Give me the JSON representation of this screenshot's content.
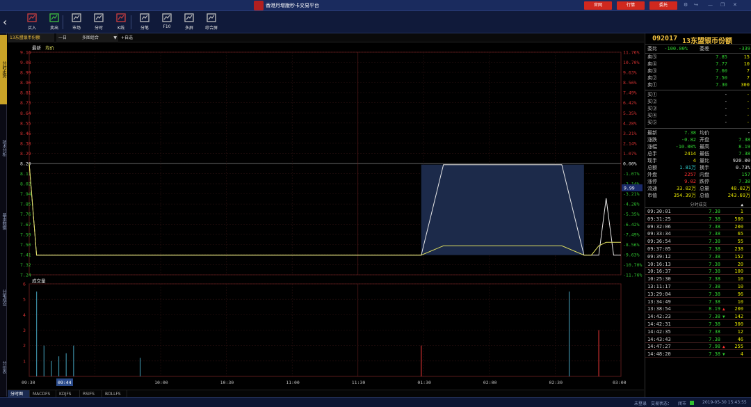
{
  "window": {
    "title": "香港月增版秒卡交易平台",
    "buttons": [
      "官网",
      "行情",
      "委托"
    ],
    "icons": [
      "settings-icon",
      "exit-icon",
      "minimize-icon",
      "restore-icon",
      "close-icon"
    ]
  },
  "toolbar": {
    "items": [
      {
        "label": "买入",
        "icon": "buy-icon",
        "color": "#d04040"
      },
      {
        "label": "卖出",
        "icon": "sell-icon",
        "color": "#40c040"
      },
      {
        "label": "市场",
        "icon": "market-icon",
        "color": "#c0c0c0"
      },
      {
        "label": "分时",
        "icon": "timeshare-icon",
        "color": "#c0c0c0"
      },
      {
        "label": "K线",
        "icon": "candlestick-icon",
        "color": "#d04040"
      },
      {
        "label": "分笔",
        "icon": "ticks-icon",
        "color": "#c0c0c0"
      },
      {
        "label": "F10",
        "icon": "document-icon",
        "color": "#c0c0c0"
      },
      {
        "label": "多屏",
        "icon": "multi-screen-icon",
        "color": "#c0c0c0"
      },
      {
        "label": "综合屏",
        "icon": "grid-screen-icon",
        "color": "#c0c0c0"
      }
    ]
  },
  "left_tabs": [
    "分时走势",
    "技术分析",
    "基本数据",
    "分笔成交",
    "分价表"
  ],
  "chart_bar": {
    "code_name": "13东盟银币份额",
    "period": "一日",
    "mode": "多图组合",
    "add_button": "+自选"
  },
  "bottom_tabs": [
    "分时图",
    "MACDFS",
    "KDJFS",
    "RSIFS",
    "BOLLFS"
  ],
  "status": {
    "login": "未登录",
    "trade_state": "交易状态：",
    "market_state": "闭市",
    "datetime": "2019-05-30 15:43:55"
  },
  "chart_data": {
    "type": "line",
    "legend": [
      "最新",
      "均价"
    ],
    "x_ticks": [
      "09:30",
      "09:44",
      "10:00",
      "10:30",
      "11:00",
      "11:30",
      "01:30",
      "02:00",
      "02:30",
      "03:00"
    ],
    "x_highlight": "09:44",
    "y_left_ticks": [
      "9.16",
      "9.08",
      "8.99",
      "8.90",
      "8.81",
      "8.73",
      "8.64",
      "8.55",
      "8.46",
      "8.38",
      "8.29",
      "8.20",
      "8.11",
      "8.02",
      "7.94",
      "7.85",
      "7.76",
      "7.67",
      "7.59",
      "7.50",
      "7.41",
      "7.32",
      "7.24"
    ],
    "y_right_ticks": [
      "11.76%",
      "10.70%",
      "9.63%",
      "8.56%",
      "7.49%",
      "6.42%",
      "5.35%",
      "4.28%",
      "3.21%",
      "2.14%",
      "1.07%",
      "0.00%",
      "-1.07%",
      "-2.14%",
      "-3.21%",
      "-4.28%",
      "-5.35%",
      "-6.42%",
      "-7.49%",
      "-8.56%",
      "-9.63%",
      "-10.70%",
      "-11.76%"
    ],
    "cursor_label": "9.99",
    "ylim": [
      7.24,
      9.16
    ],
    "prev_close": 8.2,
    "series": [
      {
        "name": "最新",
        "color": "#e8e8e8",
        "x": [
          0,
          1,
          2,
          53,
          56,
          72,
          75,
          76,
          77,
          78,
          79,
          80
        ],
        "y": [
          8.2,
          7.41,
          7.41,
          7.41,
          8.19,
          8.19,
          7.41,
          7.41,
          7.41,
          7.9,
          7.41,
          7.41
        ]
      },
      {
        "name": "均价",
        "color": "#e0e060",
        "x": [
          0,
          1,
          2,
          53,
          56,
          72,
          75,
          76,
          77,
          78,
          79,
          80
        ],
        "y": [
          8.2,
          7.41,
          7.41,
          7.41,
          7.49,
          7.49,
          7.41,
          7.41,
          7.49,
          7.52,
          7.52,
          7.52
        ]
      }
    ],
    "volume": {
      "title": "成交量",
      "y_ticks": [
        "6",
        "5",
        "4",
        "3",
        "2",
        "1"
      ],
      "ylim": [
        0,
        6
      ],
      "bars": [
        {
          "x": 1,
          "v": 5.5,
          "dir": "flat"
        },
        {
          "x": 2,
          "v": 2,
          "dir": "flat"
        },
        {
          "x": 3,
          "v": 1,
          "dir": "flat"
        },
        {
          "x": 4,
          "v": 1.3,
          "dir": "flat"
        },
        {
          "x": 5,
          "v": 1.5,
          "dir": "flat"
        },
        {
          "x": 6,
          "v": 2,
          "dir": "flat"
        },
        {
          "x": 15,
          "v": 1.2,
          "dir": "flat"
        },
        {
          "x": 53,
          "v": 2,
          "dir": "up"
        },
        {
          "x": 73,
          "v": 5.5,
          "dir": "flat"
        },
        {
          "x": 77,
          "v": 3,
          "dir": "up"
        }
      ]
    }
  },
  "quote": {
    "code": "092017",
    "name": "13东盟银币份额",
    "weibi_label": "委比",
    "weibi": "-100.00%",
    "weicha_label": "委差",
    "weicha": "-339",
    "sells": [
      {
        "label": "卖⑤",
        "price": "7.85",
        "qty": "15"
      },
      {
        "label": "卖④",
        "price": "7.77",
        "qty": "10"
      },
      {
        "label": "卖③",
        "price": "7.60",
        "qty": "7"
      },
      {
        "label": "卖②",
        "price": "7.50",
        "qty": "7"
      },
      {
        "label": "卖①",
        "price": "7.30",
        "qty": "300"
      }
    ],
    "buys": [
      {
        "label": "买①",
        "price": "-",
        "qty": "-"
      },
      {
        "label": "买②",
        "price": "-",
        "qty": "-"
      },
      {
        "label": "买③",
        "price": "-",
        "qty": "-"
      },
      {
        "label": "买④",
        "price": "-",
        "qty": "-"
      },
      {
        "label": "买⑤",
        "price": "-",
        "qty": "-"
      }
    ],
    "stats": [
      {
        "k": "最新",
        "v": "7.38",
        "vc": "green",
        "k2": "均价",
        "v2": "-",
        "v2c": "white"
      },
      {
        "k": "涨跌",
        "v": "-0.82",
        "vc": "green",
        "k2": "开盘",
        "v2": "7.38",
        "v2c": "green"
      },
      {
        "k": "涨幅",
        "v": "-10.00%",
        "vc": "green",
        "k2": "最高",
        "v2": "8.19",
        "v2c": "green"
      },
      {
        "k": "总手",
        "v": "2414",
        "vc": "yellow",
        "k2": "最低",
        "v2": "7.38",
        "v2c": "green"
      },
      {
        "k": "现手",
        "v": "4",
        "vc": "yellow",
        "k2": "量比",
        "v2": "920.00",
        "v2c": "white"
      },
      {
        "k": "总额",
        "v": "1.81万",
        "vc": "cyan",
        "k2": "换手",
        "v2": "0.73%",
        "v2c": "white"
      },
      {
        "k": "外盘",
        "v": "2257",
        "vc": "red",
        "k2": "内盘",
        "v2": "157",
        "v2c": "green"
      },
      {
        "k": "涨停",
        "v": "9.02",
        "vc": "red",
        "k2": "跌停",
        "v2": "7.38",
        "v2c": "green"
      },
      {
        "k": "流通",
        "v": "33.02万",
        "vc": "yellow",
        "k2": "总量",
        "v2": "48.02万",
        "v2c": "yellow"
      },
      {
        "k": "市值",
        "v": "354.39万",
        "vc": "yellow",
        "k2": "总值",
        "v2": "243.69万",
        "v2c": "yellow"
      }
    ],
    "ticks_title": "分时成交",
    "ticks": [
      {
        "t": "09:30:01",
        "p": "7.38",
        "pc": "green",
        "a": "",
        "v": "1",
        "vc": "green"
      },
      {
        "t": "09:31:25",
        "p": "7.38",
        "pc": "green",
        "a": "",
        "v": "500",
        "vc": "red"
      },
      {
        "t": "09:32:06",
        "p": "7.38",
        "pc": "green",
        "a": "",
        "v": "200",
        "vc": "red"
      },
      {
        "t": "09:33:34",
        "p": "7.38",
        "pc": "green",
        "a": "",
        "v": "65",
        "vc": "red"
      },
      {
        "t": "09:36:54",
        "p": "7.38",
        "pc": "green",
        "a": "",
        "v": "55",
        "vc": "red"
      },
      {
        "t": "09:37:05",
        "p": "7.38",
        "pc": "green",
        "a": "",
        "v": "238",
        "vc": "red"
      },
      {
        "t": "09:39:12",
        "p": "7.38",
        "pc": "green",
        "a": "",
        "v": "152",
        "vc": "red"
      },
      {
        "t": "10:16:13",
        "p": "7.38",
        "pc": "green",
        "a": "",
        "v": "20",
        "vc": "red"
      },
      {
        "t": "10:16:37",
        "p": "7.38",
        "pc": "green",
        "a": "",
        "v": "100",
        "vc": "red"
      },
      {
        "t": "10:25:30",
        "p": "7.38",
        "pc": "green",
        "a": "",
        "v": "10",
        "vc": "red"
      },
      {
        "t": "13:11:17",
        "p": "7.38",
        "pc": "green",
        "a": "",
        "v": "10",
        "vc": "red"
      },
      {
        "t": "13:29:04",
        "p": "7.38",
        "pc": "green",
        "a": "",
        "v": "96",
        "vc": "red"
      },
      {
        "t": "13:34:49",
        "p": "7.38",
        "pc": "green",
        "a": "",
        "v": "10",
        "vc": "red"
      },
      {
        "t": "13:38:54",
        "p": "8.19",
        "pc": "green",
        "a": "▲",
        "v": "200",
        "vc": "red"
      },
      {
        "t": "14:42:23",
        "p": "7.38",
        "pc": "green",
        "a": "▼",
        "v": "142",
        "vc": "green"
      },
      {
        "t": "14:42:31",
        "p": "7.38",
        "pc": "green",
        "a": "",
        "v": "300",
        "vc": "red"
      },
      {
        "t": "14:42:35",
        "p": "7.38",
        "pc": "green",
        "a": "",
        "v": "12",
        "vc": "red"
      },
      {
        "t": "14:43:43",
        "p": "7.38",
        "pc": "green",
        "a": "",
        "v": "46",
        "vc": "red"
      },
      {
        "t": "14:47:27",
        "p": "7.98",
        "pc": "green",
        "a": "▲",
        "v": "255",
        "vc": "red"
      },
      {
        "t": "14:48:20",
        "p": "7.38",
        "pc": "green",
        "a": "▼",
        "v": "4",
        "vc": "green"
      }
    ]
  }
}
